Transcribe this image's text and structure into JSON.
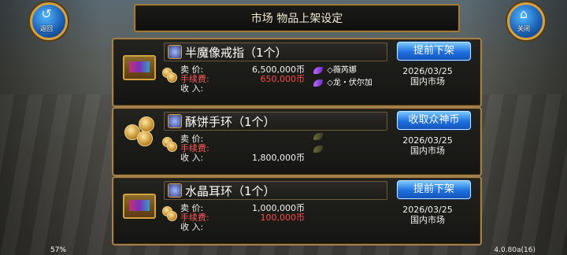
{
  "header": {
    "title": "市场  物品上架设定",
    "left_button_label": "返回",
    "right_button_label": "关闭"
  },
  "listings": [
    {
      "name": "半魔像戒指（1个）",
      "action": "提前下架",
      "sell_price_label": "卖    价:",
      "fee_label": "手续费:",
      "income_label": "收    入:",
      "sell_price": "6,500,000币",
      "fee": "650,000币",
      "income": "",
      "buyers": [
        "◇薇芮娜",
        "◇龙・伏尔加"
      ],
      "date": "2026/03/25",
      "market": "国内市场"
    },
    {
      "name": "酥饼手环（1个）",
      "action": "收取众神币",
      "sell_price_label": "卖    价:",
      "fee_label": "手续费:",
      "income_label": "收    入:",
      "sell_price": "",
      "fee": "",
      "income": "1,800,000币",
      "buyers": [
        "",
        ""
      ],
      "date": "2026/03/25",
      "market": "国内市场"
    },
    {
      "name": "水晶耳环（1个）",
      "action": "提前下架",
      "sell_price_label": "卖    价:",
      "fee_label": "手续费:",
      "income_label": "收    入:",
      "sell_price": "1,000,000币",
      "fee": "100,000币",
      "income": "",
      "buyers": [
        "",
        ""
      ],
      "date": "2026/03/25",
      "market": "国内市场"
    }
  ],
  "footer": {
    "ping": "57%",
    "version": "4.0.80a(16)"
  },
  "colors": {
    "frame_gold": "#a2804a",
    "button_blue": "#1e6fe0",
    "fee_red": "#ff4a4a"
  }
}
